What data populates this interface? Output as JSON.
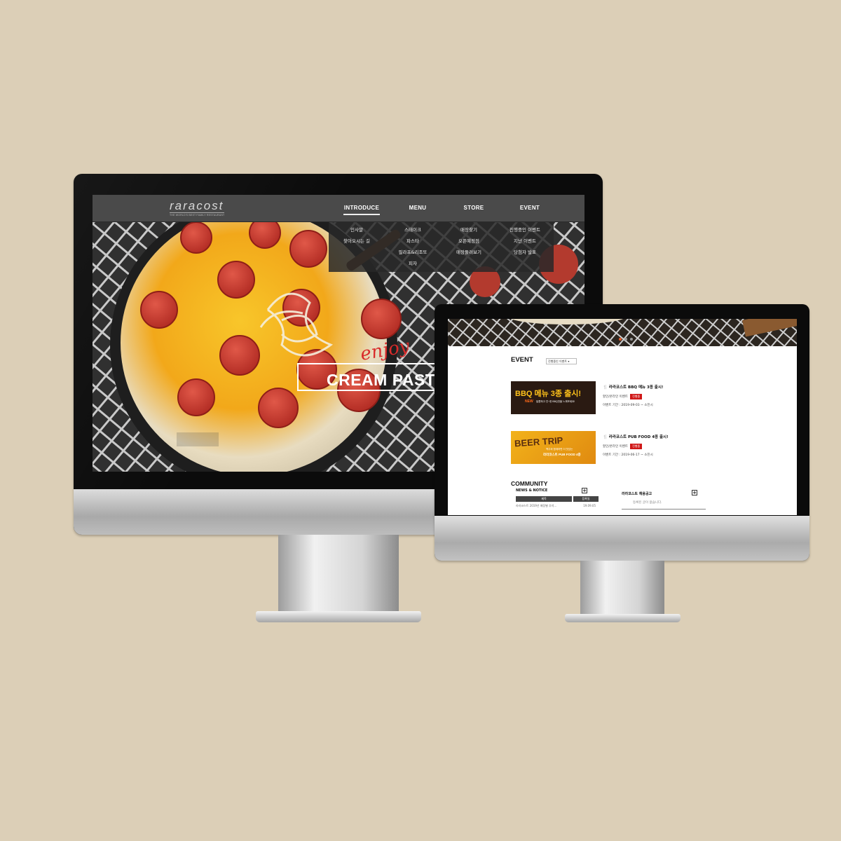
{
  "brand": {
    "logo_text": "raracost",
    "tagline": "THE WORLD'S BEST FAMILY RESTAURANT"
  },
  "desktop": {
    "nav": [
      {
        "label": "INTRODUCE",
        "active": true
      },
      {
        "label": "MENU"
      },
      {
        "label": "STORE"
      },
      {
        "label": "EVENT"
      }
    ],
    "dropdown": [
      [
        "인사말",
        "찾아오시는 길"
      ],
      [
        "스테이크",
        "파스타",
        "필라프&리조또",
        "피자"
      ],
      [
        "매장찾기",
        "오픈예정점",
        "매장둘러보기"
      ],
      [
        "진행중인 이벤트",
        "지난 이벤트",
        "당첨자 발표"
      ]
    ],
    "hero": {
      "script": "enjoy",
      "headline": "CREAM PASTA",
      "dots": 3,
      "active_dot": 1
    }
  },
  "event_page": {
    "title": "EVENT",
    "filter_selected": "진행중인 이벤트",
    "events": [
      {
        "banner_main": "BBQ 메뉴 3종 출시!",
        "banner_badge": "NEW",
        "banner_sub": "달콤하고 진~한 BBQ맛을 느껴보세요!",
        "title": "라라코스트 BBQ 메뉴 3종 출시!",
        "type": "할인/온라인 이벤트",
        "status": "진행중",
        "period": "이벤트 기간 : 2019-09-03 ~ 소진시"
      },
      {
        "banner_main": "BEER TRIP",
        "banner_sub": "맥주와 함께하면 더 맛있는",
        "banner_sub2": "라라코스트 PUB FOOD 4종",
        "title": "라라코스트 PUB FOOD 4종 출시!",
        "type": "할인/온라인 이벤트",
        "status": "진행중",
        "period": "이벤트 기간 : 2019-06-17 ~ 소진시"
      }
    ],
    "community": {
      "title": "COMMUNITY",
      "news_title": "NEWS & NOTICE",
      "col_title": "제목",
      "col_date": "등록일",
      "rows": [
        {
          "title": "라라코스트 2019년 매장별 추석...",
          "date": "19.09.05"
        }
      ],
      "jobs_title": "라라코스트 채용공고",
      "jobs_empty": "등록된 글이 없습니다."
    },
    "dots": 3,
    "active_dot": 1
  },
  "colors": {
    "background": "#dccfb7",
    "accent_red": "#d01818",
    "nav_bar": "#4a4a4a"
  }
}
